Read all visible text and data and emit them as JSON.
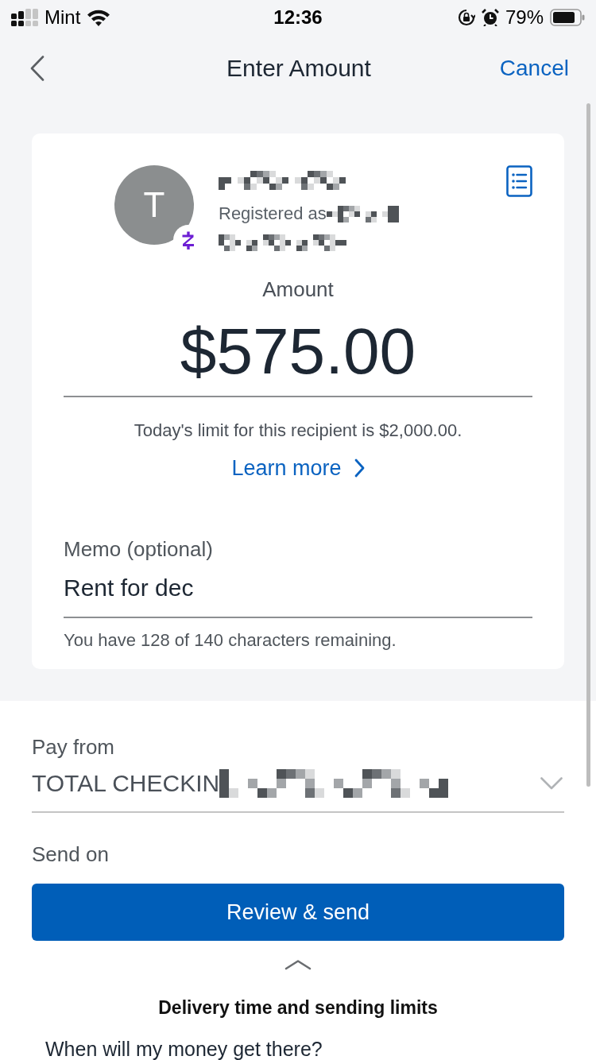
{
  "status_bar": {
    "carrier": "Mint",
    "time": "12:36",
    "battery": "79%"
  },
  "nav": {
    "title": "Enter Amount",
    "cancel": "Cancel"
  },
  "recipient": {
    "initial": "T",
    "registered_label": "Registered as"
  },
  "amount": {
    "label": "Amount",
    "value": "$575.00"
  },
  "limit": {
    "text": "Today's limit for this recipient is $2,000.00.",
    "link": "Learn more"
  },
  "memo": {
    "label": "Memo (optional)",
    "value": "Rent for dec",
    "hint": "You have 128 of 140 characters remaining."
  },
  "pay_from": {
    "label": "Pay from",
    "value": "TOTAL CHECKIN"
  },
  "send_on": {
    "label": "Send on"
  },
  "footer": {
    "button": "Review & send",
    "title": "Delivery time and sending limits",
    "question": "When will my money get there?"
  }
}
